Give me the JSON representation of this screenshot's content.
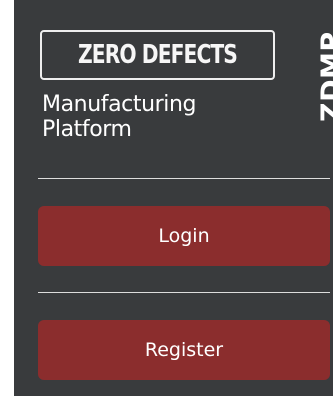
{
  "logo": {
    "headline": "ZERO DEFECTS",
    "subtitle_line1": "Manufacturing",
    "subtitle_line2": "Platform",
    "acronym": "ZDMP"
  },
  "actions": {
    "login_label": "Login",
    "register_label": "Register"
  },
  "colors": {
    "panel_background": "#393b3d",
    "button_background": "#8b2d2d",
    "text": "#ffffff"
  }
}
